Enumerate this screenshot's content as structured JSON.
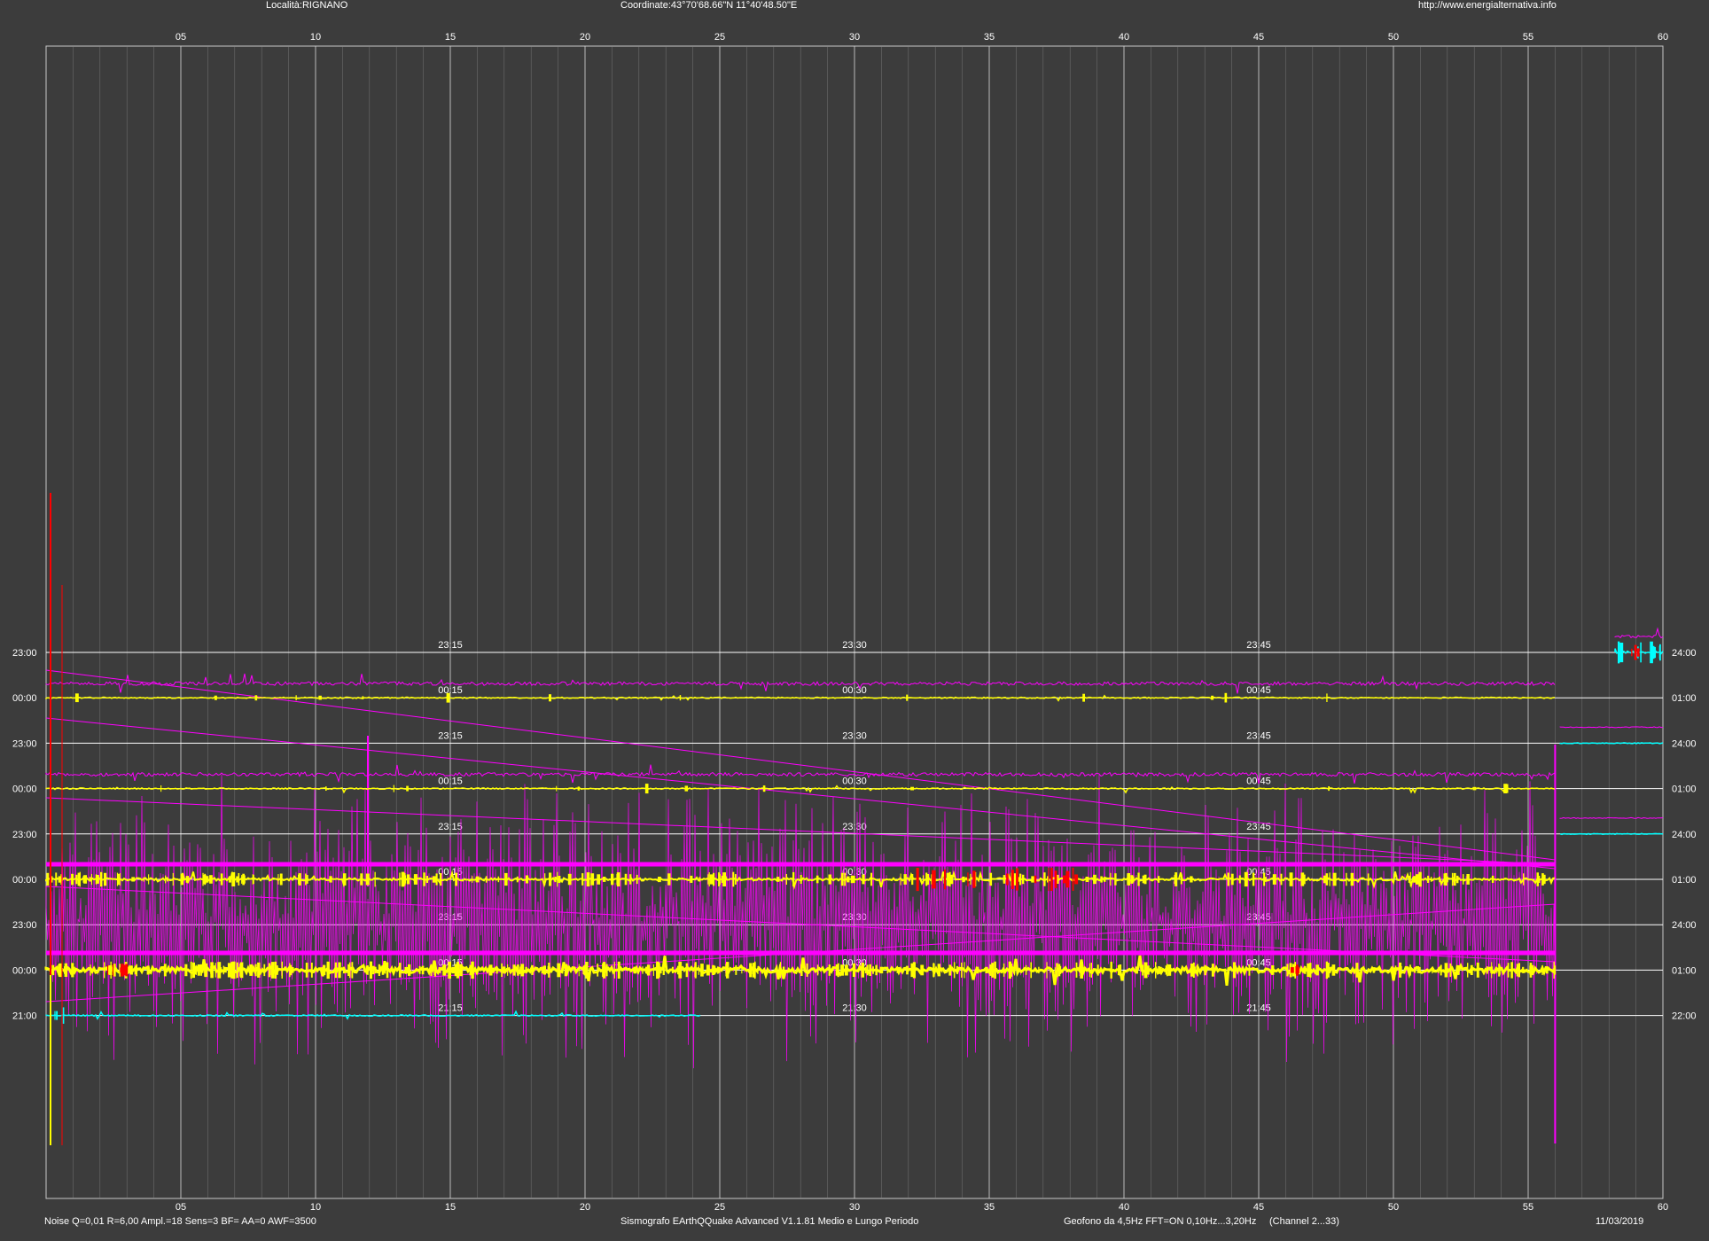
{
  "header": {
    "location": "Località:RIGNANO",
    "coordinates": "Coordinate:43°70'68.66\"N  11°40'48.50\"E",
    "url": "http://www.energialternativa.info"
  },
  "footer": {
    "noise": "Noise Q=0,01 R=6,00 Ampl.=18 Sens=3 BF= AA=0 AWF=3500",
    "software": "Sismografo  EArthQQuake Advanced V1.1.81  Medio e Lungo Periodo",
    "geophone": "Geofono da 4,5Hz FFT=ON 0,10Hz...3,20Hz",
    "channel": "(Channel 2...33)",
    "date": "11/03/2019"
  },
  "colors": {
    "background": "#3c3c3c",
    "grid_major": "#c8c8c8",
    "grid_minor": "#8a8a8a",
    "line": "#ffffff",
    "yellow": "#ffff00",
    "magenta": "#ff00ff",
    "cyan": "#00ffff",
    "red": "#ff0000"
  },
  "chart_data": {
    "type": "line",
    "x": {
      "min": 0,
      "max": 60,
      "ticks": [
        "05",
        "10",
        "15",
        "20",
        "25",
        "30",
        "35",
        "40",
        "45",
        "50",
        "55",
        "60"
      ],
      "unit": "minutes"
    },
    "grid": true,
    "rows": [
      {
        "left": "23:00",
        "right": "24:00",
        "marks": [
          "23:15",
          "23:30",
          "23:45"
        ],
        "color": "cyan",
        "signal": "cyan-end"
      },
      {
        "left": "00:00",
        "right": "01:00",
        "marks": [
          "00:15",
          "00:30",
          "00:45"
        ],
        "color": "yellow",
        "signal": "yellow-quiet"
      },
      {
        "left": "23:00",
        "right": "24:00",
        "marks": [
          "23:15",
          "23:30",
          "23:45"
        ],
        "color": "cyan",
        "signal": "cyan-end-short"
      },
      {
        "left": "00:00",
        "right": "01:00",
        "marks": [
          "00:15",
          "00:30",
          "00:45"
        ],
        "color": "yellow",
        "signal": "yellow-quiet"
      },
      {
        "left": "23:00",
        "right": "24:00",
        "marks": [
          "23:15",
          "23:30",
          "23:45"
        ],
        "color": "cyan",
        "signal": "cyan-end-short"
      },
      {
        "left": "00:00",
        "right": "01:00",
        "marks": [
          "00:15",
          "00:30",
          "00:45"
        ],
        "color": "yellow",
        "signal": "yellow-active"
      },
      {
        "left": "23:00",
        "right": "24:00",
        "marks": [
          "23:15",
          "23:30",
          "23:45"
        ],
        "color": "none",
        "signal": "none"
      },
      {
        "left": "00:00",
        "right": "01:00",
        "marks": [
          "00:15",
          "00:30",
          "00:45"
        ],
        "color": "yellow",
        "signal": "yellow-busy"
      },
      {
        "left": "21:00",
        "right": "22:00",
        "marks": [
          "21:15",
          "21:30",
          "21:45"
        ],
        "color": "cyan",
        "signal": "cyan-partial"
      }
    ],
    "trace_end_minute": 56
  }
}
